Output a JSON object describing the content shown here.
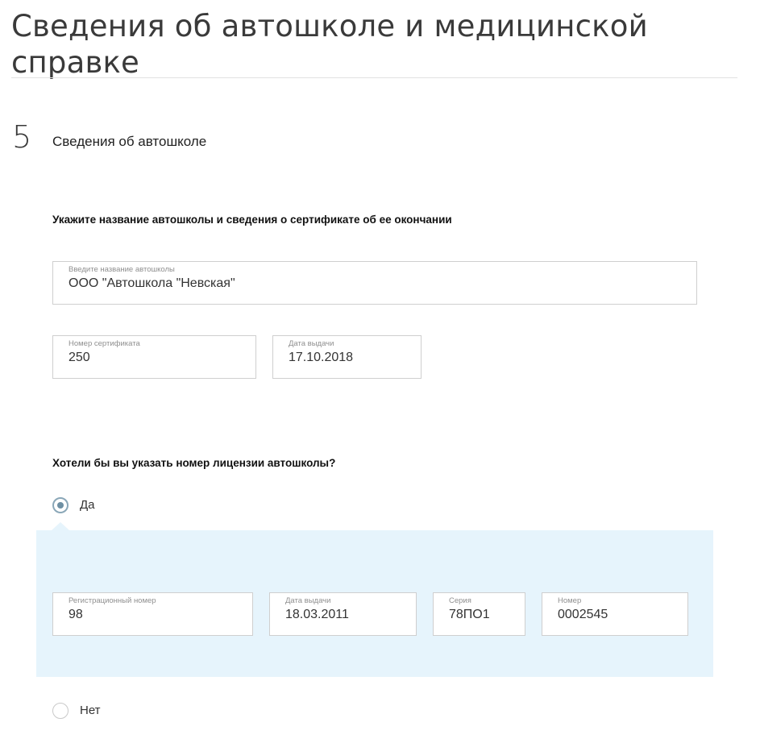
{
  "page": {
    "title": "Сведения об автошколе и медицинской справке"
  },
  "step": {
    "number": "5",
    "title": "Сведения об автошколе"
  },
  "school_section": {
    "question": "Укажите название автошколы и сведения о сертификате об ее окончании",
    "school_name": {
      "label": "Введите название автошколы",
      "value": "ООО \"Автошкола \"Невская\""
    },
    "certificate_number": {
      "label": "Номер сертификата",
      "value": "250"
    },
    "certificate_date": {
      "label": "Дата выдачи",
      "value": "17.10.2018"
    }
  },
  "license_section": {
    "question": "Хотели бы вы указать номер лицензии автошколы?",
    "option_yes": {
      "label": "Да",
      "checked": true
    },
    "option_no": {
      "label": "Нет",
      "checked": false
    },
    "registration_number": {
      "label": "Регистрационный номер",
      "value": "98"
    },
    "issue_date": {
      "label": "Дата выдачи",
      "value": "18.03.2011"
    },
    "series": {
      "label": "Серия",
      "value": "78ПО1"
    },
    "number": {
      "label": "Номер",
      "value": "0002545"
    }
  },
  "colors": {
    "panel_background": "#e6f4fc",
    "radio_checked": "#6e8fa3",
    "field_border": "#cfcfcf",
    "label_gray": "#8f8f8f"
  }
}
